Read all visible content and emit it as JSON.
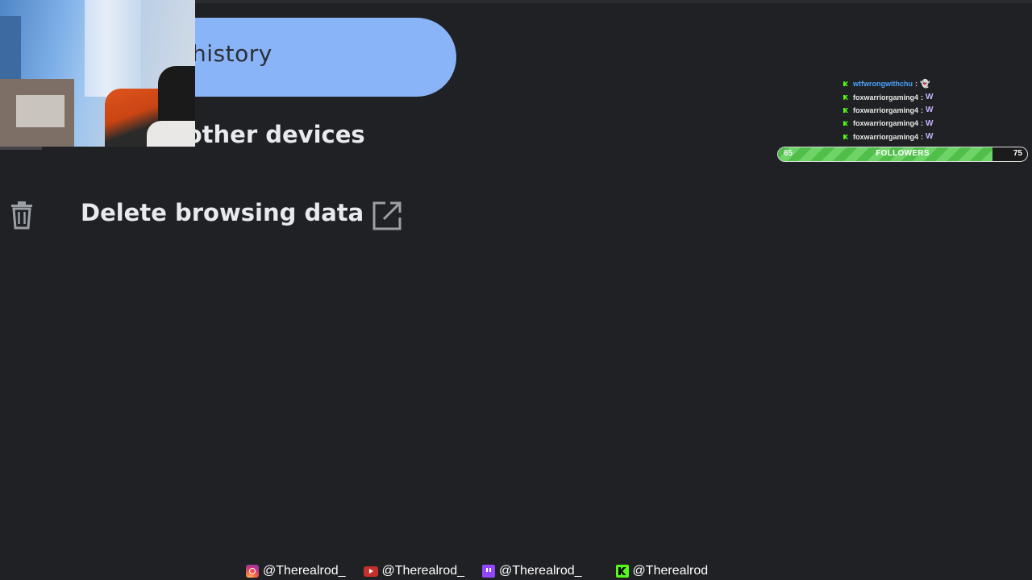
{
  "browser": {
    "history_label": "history",
    "other_devices_label": "n other devices",
    "delete_label": "Delete browsing data",
    "accent_color": "#8ab4f8"
  },
  "stream_overlay": {
    "chat": [
      {
        "user": "wtfwrongwithchu",
        "sep": ":",
        "emote": "👻"
      },
      {
        "user": "foxwarriorgaming4",
        "sep": ":",
        "emote": "W"
      },
      {
        "user": "foxwarriorgaming4",
        "sep": ":",
        "emote": "W"
      },
      {
        "user": "foxwarriorgaming4",
        "sep": ":",
        "emote": "W"
      },
      {
        "user": "foxwarriorgaming4",
        "sep": ":",
        "emote": "W"
      }
    ],
    "followers": {
      "label": "FOLLOWERS",
      "start": "65",
      "goal": "75",
      "fill_fraction": 0.86,
      "color": "#4fbf4a"
    },
    "socials": [
      {
        "icon": "instagram-icon",
        "handle": "@Therealrod_"
      },
      {
        "icon": "youtube-icon",
        "handle": "@Therealrod_"
      },
      {
        "icon": "twitch-icon",
        "handle": "@Therealrod_"
      },
      {
        "icon": "kick-icon",
        "handle": "@Therealrod"
      }
    ]
  }
}
